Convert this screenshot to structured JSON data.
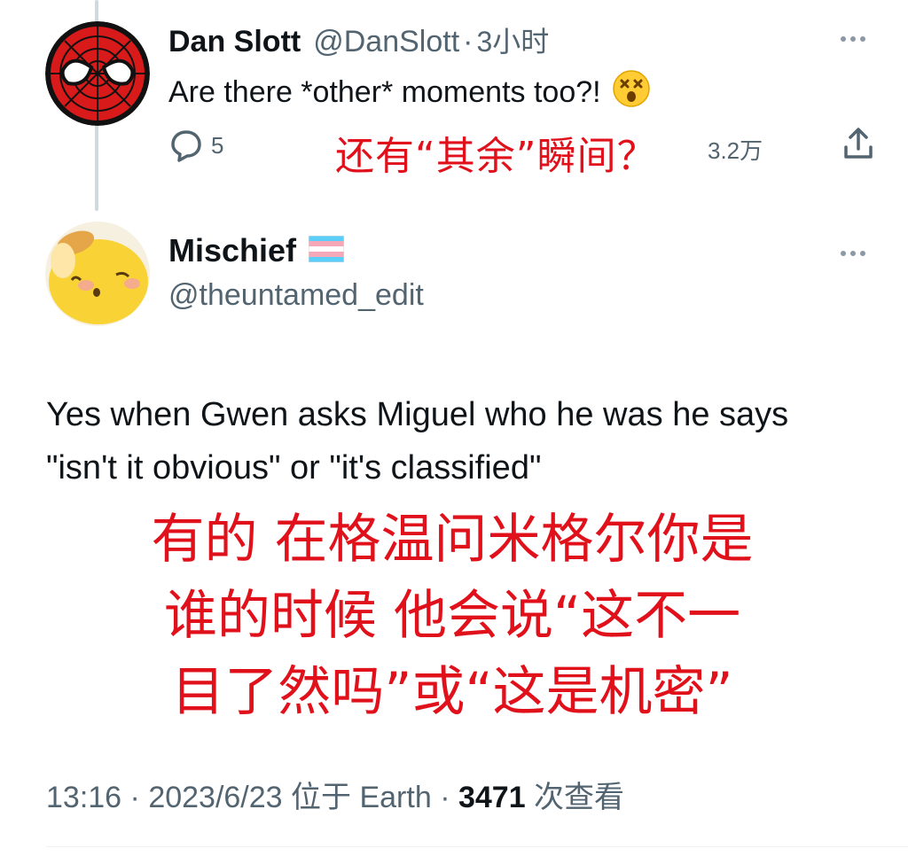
{
  "reply_tweet": {
    "display_name": "Dan Slott",
    "handle": "@DanSlott",
    "separator": "·",
    "time": "3小时",
    "text": "Are there *other* moments too?!",
    "emoji": "dizzy-face",
    "actions": {
      "replies": "5",
      "views": "3.2万"
    },
    "overlay_translation": "还有“其余”瞬间？"
  },
  "main_tweet": {
    "display_name": "Mischief",
    "flag": "transgender-flag",
    "handle": "@theuntamed_edit",
    "text": "Yes when Gwen asks Miguel who he was he says \"isn't it obvious\" or \"it's classified\"",
    "overlay_translation": [
      "有的 在格温问米格尔你是",
      "谁的时候 他会说“这不一",
      "目了然吗”或“这是机密”"
    ],
    "footer": {
      "time": "13:16",
      "separator_1": " · ",
      "date": "2023/6/23",
      "location": " 位于 Earth",
      "separator_2": " · ",
      "views_number": "3471",
      "views_label": " 次查看"
    }
  },
  "colors": {
    "secondary_text": "#536471",
    "primary_text": "#0f1419",
    "overlay_red": "#e0111b",
    "thread_line": "#cfd9de"
  }
}
